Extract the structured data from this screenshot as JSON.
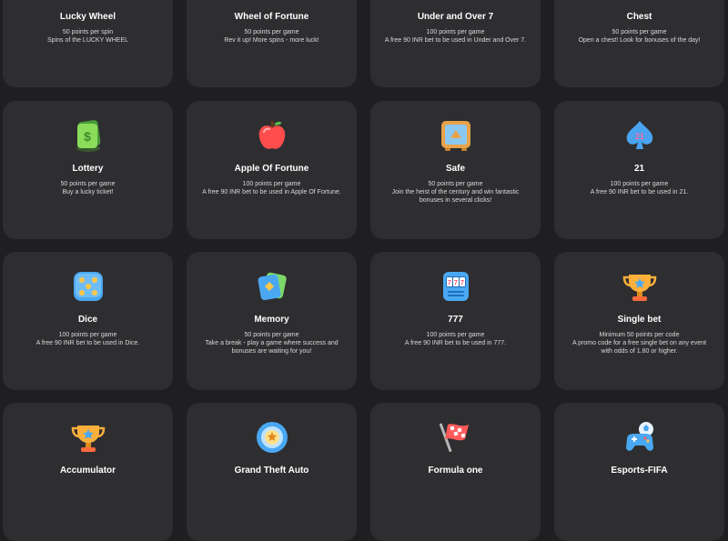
{
  "colors": {
    "page_bg": "#1f1f21",
    "card_bg": "#2e2e31",
    "text_primary": "#ffffff",
    "text_secondary": "#d8d8d8"
  },
  "cards": [
    {
      "title": "Lucky Wheel",
      "points": "50 points per spin",
      "description": "Spins of the LUCKY WHEEL",
      "icon": "wheel-icon"
    },
    {
      "title": "Wheel of Fortune",
      "points": "50 points per game",
      "description": "Rev it up! More spins - more luck!",
      "icon": "wheel-icon"
    },
    {
      "title": "Under and Over 7",
      "points": "100 points per game",
      "description": "A free 90 INR bet to be used in Under and Over 7.",
      "icon": "dice-icon"
    },
    {
      "title": "Chest",
      "points": "50 points per game",
      "description": "Open a chest! Look for bonuses of the day!",
      "icon": "chest-icon"
    },
    {
      "title": "Lottery",
      "points": "50 points per game",
      "description": "Buy a lucky ticket!",
      "icon": "lottery-ticket-icon"
    },
    {
      "title": "Apple Of Fortune",
      "points": "100 points per game",
      "description": "A free 90 INR bet to be used in Apple Of Fortune.",
      "icon": "apple-icon"
    },
    {
      "title": "Safe",
      "points": "50 points per game",
      "description": "Join the heist of the century and win fantastic bonuses in several clicks!",
      "icon": "safe-icon"
    },
    {
      "title": "21",
      "points": "100 points per game",
      "description": "A free 90 INR bet to be used in 21.",
      "icon": "spade-card-icon"
    },
    {
      "title": "Dice",
      "points": "100 points per game",
      "description": "A free 90 INR bet to be used in Dice.",
      "icon": "dice-icon"
    },
    {
      "title": "Memory",
      "points": "50 points per game",
      "description": "Take a break - play a game where success and bonuses are waiting for you!",
      "icon": "memory-cards-icon"
    },
    {
      "title": "777",
      "points": "100 points per game",
      "description": "A free 90 INR bet to be used in 777.",
      "icon": "slot-machine-icon"
    },
    {
      "title": "Single bet",
      "points": "Minimum 50 points per code",
      "description": "A promo code for a free single bet on any event with odds of 1.80 or higher.",
      "icon": "trophy-icon"
    },
    {
      "title": "Accumulator",
      "points": "",
      "description": "",
      "icon": "trophy-icon"
    },
    {
      "title": "Grand Theft Auto",
      "points": "",
      "description": "",
      "icon": "gta-badge-icon"
    },
    {
      "title": "Formula one",
      "points": "",
      "description": "",
      "icon": "checkered-flag-icon"
    },
    {
      "title": "Esports-FIFA",
      "points": "",
      "description": "",
      "icon": "gamepad-ball-icon"
    }
  ]
}
